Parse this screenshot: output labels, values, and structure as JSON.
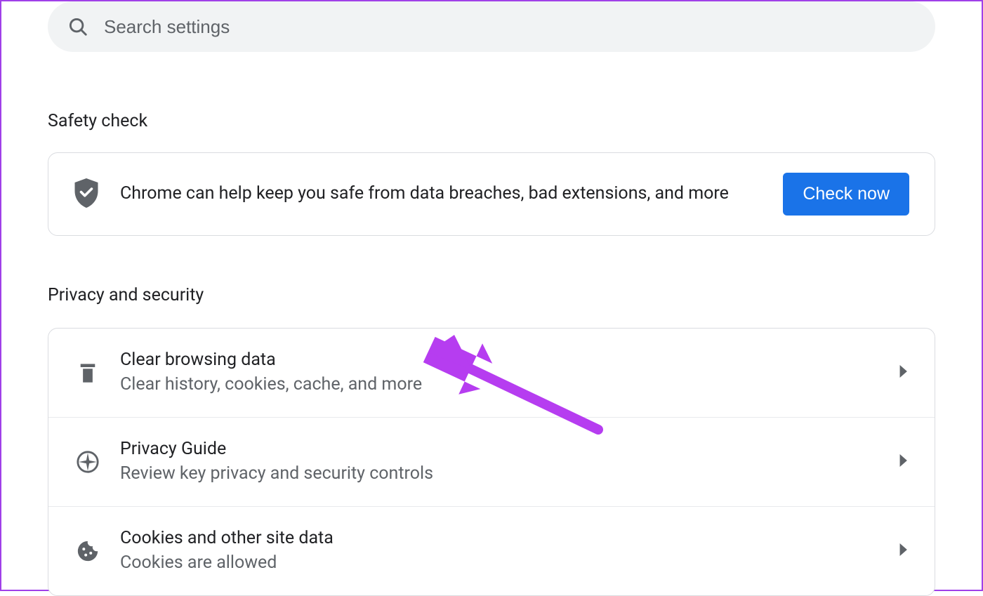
{
  "search": {
    "placeholder": "Search settings"
  },
  "sections": {
    "safety": {
      "heading": "Safety check",
      "text": "Chrome can help keep you safe from data breaches, bad extensions, and more",
      "button": "Check now"
    },
    "privacy": {
      "heading": "Privacy and security",
      "items": [
        {
          "title": "Clear browsing data",
          "subtitle": "Clear history, cookies, cache, and more"
        },
        {
          "title": "Privacy Guide",
          "subtitle": "Review key privacy and security controls"
        },
        {
          "title": "Cookies and other site data",
          "subtitle": "Cookies are allowed"
        }
      ]
    }
  }
}
